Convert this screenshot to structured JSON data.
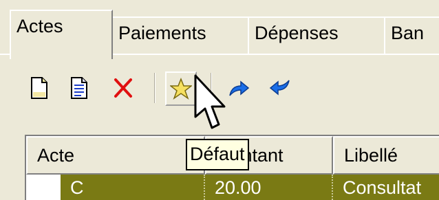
{
  "tabs": [
    {
      "label": "Actes",
      "active": true
    },
    {
      "label": "Paiements",
      "active": false
    },
    {
      "label": "Dépenses",
      "active": false
    },
    {
      "label": "Ban",
      "active": false
    }
  ],
  "toolbar": {
    "buttons": [
      {
        "name": "new-document",
        "icon": "new-document-icon"
      },
      {
        "name": "edit-document",
        "icon": "edit-document-icon"
      },
      {
        "name": "delete",
        "icon": "red-x-icon"
      },
      {
        "name": "default",
        "icon": "star-icon"
      },
      {
        "name": "move-up",
        "icon": "blue-arrow-up-icon"
      },
      {
        "name": "move-down",
        "icon": "blue-arrow-down-icon"
      }
    ]
  },
  "tooltip": {
    "text": "Défaut"
  },
  "grid": {
    "columns": [
      "Acte",
      "Montant",
      "Libellé"
    ],
    "rows": [
      [
        "C",
        "20.00",
        "Consultat"
      ]
    ]
  },
  "colors": {
    "background": "#ece9d8",
    "selected_row": "#7a7a14",
    "tooltip_bg": "#ffffe1",
    "delete_red": "#e01010",
    "arrow_blue": "#1a6ee8"
  }
}
